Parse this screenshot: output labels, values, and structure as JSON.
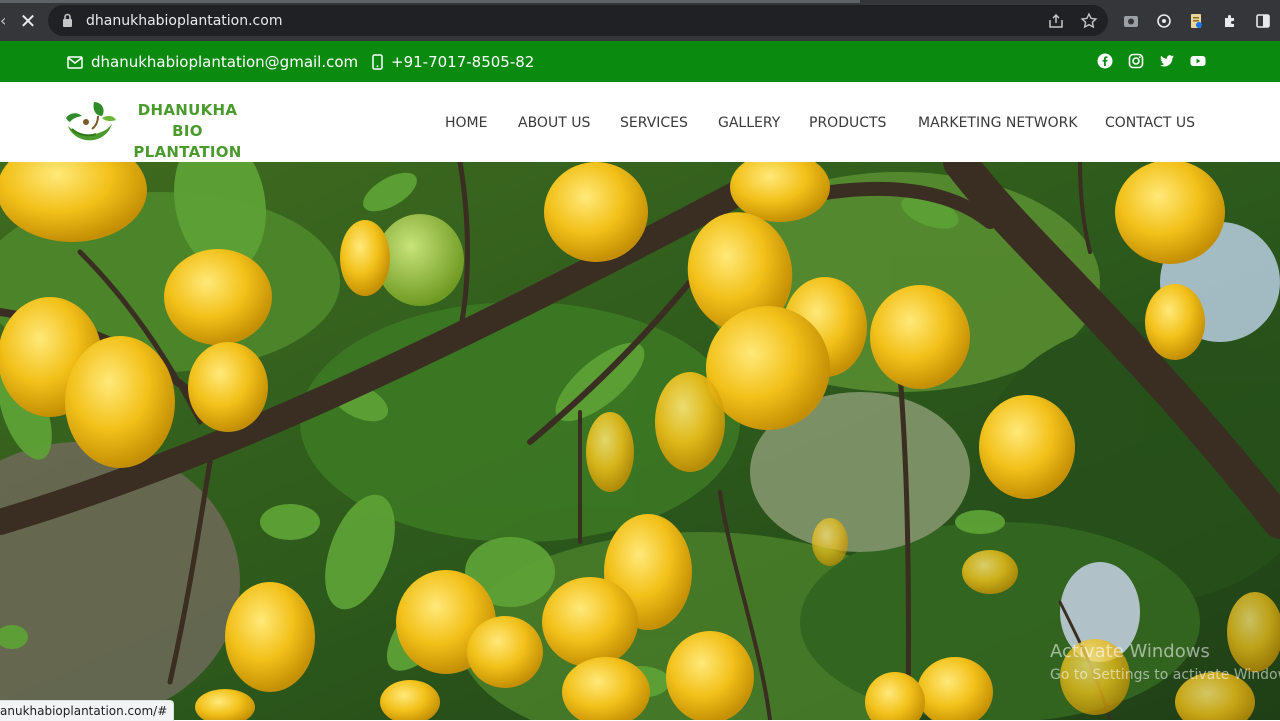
{
  "browser": {
    "url": "dhanukhabioplantation.com",
    "stop_icon": "close-icon",
    "toolbar_icons": [
      "share-icon",
      "star-icon",
      "camera-extension-icon",
      "openai-extension-icon",
      "doc-extension-icon",
      "puzzle-icon",
      "sidepanel-icon"
    ]
  },
  "topbar": {
    "email": "dhanukhabioplantation@gmail.com",
    "phone": "+91-7017-8505-82",
    "social": [
      "facebook-icon",
      "instagram-icon",
      "twitter-icon",
      "youtube-icon"
    ],
    "color": "#0b8a10"
  },
  "header": {
    "logo_line1": "DHANUKHA BIO",
    "logo_line2": "PLANTATION",
    "nav": [
      "HOME",
      "ABOUT US",
      "SERVICES",
      "GALLERY",
      "PRODUCTS",
      "MARKETING NETWORK",
      "CONTACT US"
    ],
    "logo_color": "#4b9a2e"
  },
  "hero": {
    "image": "lemon-tree-photo"
  },
  "status_bar": {
    "text": "anukhabioplantation.com/#"
  },
  "watermark": {
    "line1": "Activate Windows",
    "line2": "Go to Settings to activate Window"
  }
}
